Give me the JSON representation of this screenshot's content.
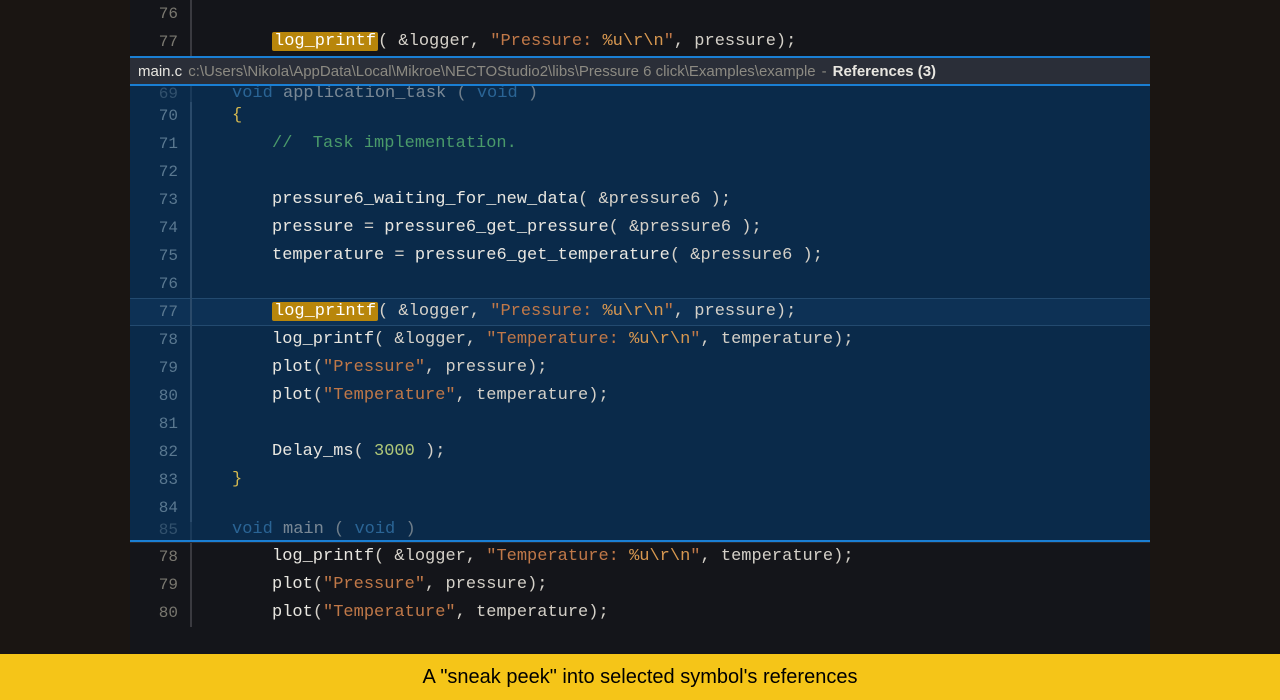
{
  "top_lines": [
    {
      "n": "76",
      "tokens": []
    },
    {
      "n": "77",
      "tokens": [
        {
          "t": "log_printf",
          "c": "tk-hl"
        },
        {
          "t": "( &logger, ",
          "c": "tk-pn"
        },
        {
          "t": "\"Pressure: ",
          "c": "tk-st"
        },
        {
          "t": "%u\\r\\n",
          "c": "tk-es"
        },
        {
          "t": "\"",
          "c": "tk-st"
        },
        {
          "t": ", pressure);",
          "c": "tk-pn"
        }
      ]
    }
  ],
  "ref_header": {
    "file": "main.c",
    "path": "c:\\Users\\Nikola\\AppData\\Local\\Mikroe\\NECTOStudio2\\libs\\Pressure 6 click\\Examples\\example",
    "sep": " - ",
    "title": "References (3)"
  },
  "peek_lines": [
    {
      "n": "69",
      "cut": true,
      "indent": 0,
      "tokens": [
        {
          "t": "void",
          "c": "tk-kw"
        },
        {
          "t": " application_task ",
          "c": "tk-fn"
        },
        {
          "t": "( ",
          "c": "tk-pn"
        },
        {
          "t": "void",
          "c": "tk-kw"
        },
        {
          "t": " )",
          "c": "tk-pn"
        }
      ]
    },
    {
      "n": "70",
      "indent": 0,
      "tokens": [
        {
          "t": "{",
          "c": "tk-br"
        }
      ]
    },
    {
      "n": "71",
      "indent": 1,
      "tokens": [
        {
          "t": "//  Task implementation.",
          "c": "tk-cm"
        }
      ]
    },
    {
      "n": "72",
      "indent": 1,
      "tokens": []
    },
    {
      "n": "73",
      "indent": 1,
      "tokens": [
        {
          "t": "pressure6_waiting_for_new_data",
          "c": "tk-fn"
        },
        {
          "t": "( &pressure6 );",
          "c": "tk-pn"
        }
      ]
    },
    {
      "n": "74",
      "indent": 1,
      "tokens": [
        {
          "t": "pressure ",
          "c": "tk-fn"
        },
        {
          "t": "=",
          "c": "tk-op"
        },
        {
          "t": " pressure6_get_pressure",
          "c": "tk-fn"
        },
        {
          "t": "( &pressure6 );",
          "c": "tk-pn"
        }
      ]
    },
    {
      "n": "75",
      "indent": 1,
      "tokens": [
        {
          "t": "temperature ",
          "c": "tk-fn"
        },
        {
          "t": "=",
          "c": "tk-op"
        },
        {
          "t": " pressure6_get_temperature",
          "c": "tk-fn"
        },
        {
          "t": "( &pressure6 );",
          "c": "tk-pn"
        }
      ]
    },
    {
      "n": "76",
      "indent": 1,
      "tokens": []
    },
    {
      "n": "77",
      "indent": 1,
      "hl": true,
      "tokens": [
        {
          "t": "log_printf",
          "c": "tk-hl"
        },
        {
          "t": "( &logger, ",
          "c": "tk-pn"
        },
        {
          "t": "\"Pressure: ",
          "c": "tk-st"
        },
        {
          "t": "%u\\r\\n",
          "c": "tk-es"
        },
        {
          "t": "\"",
          "c": "tk-st"
        },
        {
          "t": ", pressure);",
          "c": "tk-pn"
        }
      ]
    },
    {
      "n": "78",
      "indent": 1,
      "tokens": [
        {
          "t": "log_printf",
          "c": "tk-fn"
        },
        {
          "t": "( &logger, ",
          "c": "tk-pn"
        },
        {
          "t": "\"Temperature: ",
          "c": "tk-st"
        },
        {
          "t": "%u\\r\\n",
          "c": "tk-es"
        },
        {
          "t": "\"",
          "c": "tk-st"
        },
        {
          "t": ", temperature);",
          "c": "tk-pn"
        }
      ]
    },
    {
      "n": "79",
      "indent": 1,
      "tokens": [
        {
          "t": "plot",
          "c": "tk-fn"
        },
        {
          "t": "(",
          "c": "tk-pn"
        },
        {
          "t": "\"Pressure\"",
          "c": "tk-st"
        },
        {
          "t": ", pressure);",
          "c": "tk-pn"
        }
      ]
    },
    {
      "n": "80",
      "indent": 1,
      "tokens": [
        {
          "t": "plot",
          "c": "tk-fn"
        },
        {
          "t": "(",
          "c": "tk-pn"
        },
        {
          "t": "\"Temperature\"",
          "c": "tk-st"
        },
        {
          "t": ", temperature);",
          "c": "tk-pn"
        }
      ]
    },
    {
      "n": "81",
      "indent": 1,
      "tokens": []
    },
    {
      "n": "82",
      "indent": 1,
      "tokens": [
        {
          "t": "Delay_ms",
          "c": "tk-fn"
        },
        {
          "t": "( ",
          "c": "tk-pn"
        },
        {
          "t": "3000",
          "c": "tk-nm"
        },
        {
          "t": " );",
          "c": "tk-pn"
        }
      ]
    },
    {
      "n": "83",
      "indent": 0,
      "tokens": [
        {
          "t": "}",
          "c": "tk-br"
        }
      ]
    },
    {
      "n": "84",
      "indent": 0,
      "tokens": []
    },
    {
      "n": "85",
      "cut": true,
      "indent": 0,
      "tokens": [
        {
          "t": "void",
          "c": "tk-kw"
        },
        {
          "t": " main ",
          "c": "tk-fn"
        },
        {
          "t": "( ",
          "c": "tk-pn"
        },
        {
          "t": "void",
          "c": "tk-kw"
        },
        {
          "t": " )",
          "c": "tk-pn"
        }
      ]
    }
  ],
  "bottom_lines": [
    {
      "n": "78",
      "tokens": [
        {
          "t": "log_printf",
          "c": "tk-fn"
        },
        {
          "t": "( &logger, ",
          "c": "tk-pn"
        },
        {
          "t": "\"Temperature: ",
          "c": "tk-st"
        },
        {
          "t": "%u\\r\\n",
          "c": "tk-es"
        },
        {
          "t": "\"",
          "c": "tk-st"
        },
        {
          "t": ", temperature);",
          "c": "tk-pn"
        }
      ]
    },
    {
      "n": "79",
      "tokens": [
        {
          "t": "plot",
          "c": "tk-fn"
        },
        {
          "t": "(",
          "c": "tk-pn"
        },
        {
          "t": "\"Pressure\"",
          "c": "tk-st"
        },
        {
          "t": ", pressure);",
          "c": "tk-pn"
        }
      ]
    },
    {
      "n": "80",
      "tokens": [
        {
          "t": "plot",
          "c": "tk-fn"
        },
        {
          "t": "(",
          "c": "tk-pn"
        },
        {
          "t": "\"Temperature\"",
          "c": "tk-st"
        },
        {
          "t": ", temperature);",
          "c": "tk-pn"
        }
      ]
    }
  ],
  "caption": "A \"sneak peek\" into selected symbol's references"
}
